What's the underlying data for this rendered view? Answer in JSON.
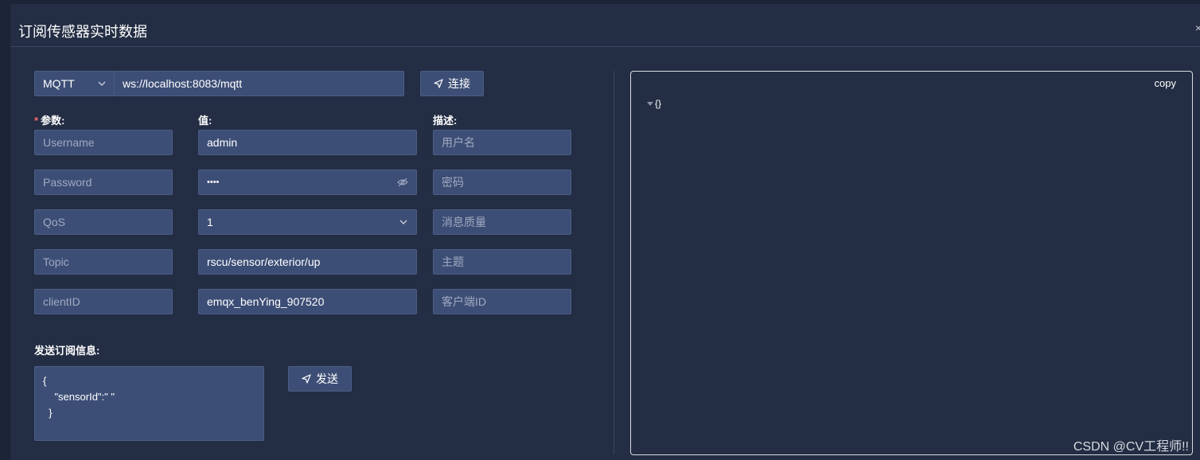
{
  "dialog": {
    "title": "订阅传感器实时数据",
    "close": "×"
  },
  "connection": {
    "protocol": "MQTT",
    "url": "ws://localhost:8083/mqtt",
    "connect_label": "连接"
  },
  "headers": {
    "param": "参数:",
    "value": "值:",
    "desc": "描述:"
  },
  "rows": [
    {
      "param": "Username",
      "value": "admin",
      "desc": "用户名"
    },
    {
      "param": "Password",
      "value": "••••",
      "desc": "密码"
    },
    {
      "param": "QoS",
      "value": "1",
      "desc": "消息质量"
    },
    {
      "param": "Topic",
      "value": "rscu/sensor/exterior/up",
      "desc": "主题"
    },
    {
      "param": "clientID",
      "value": "emqx_benYing_907520",
      "desc": "客户端ID"
    }
  ],
  "send": {
    "label": "发送订阅信息:",
    "message": "{\n    \"sensorId\":\" \"\n  }",
    "send_label": "发送"
  },
  "output": {
    "copy_label": "copy",
    "json": "{}"
  },
  "watermark": "CSDN @CV工程师!!",
  "colors": {
    "background": "#232d43",
    "input": "#3d4e76",
    "required": "#f56c6c"
  }
}
